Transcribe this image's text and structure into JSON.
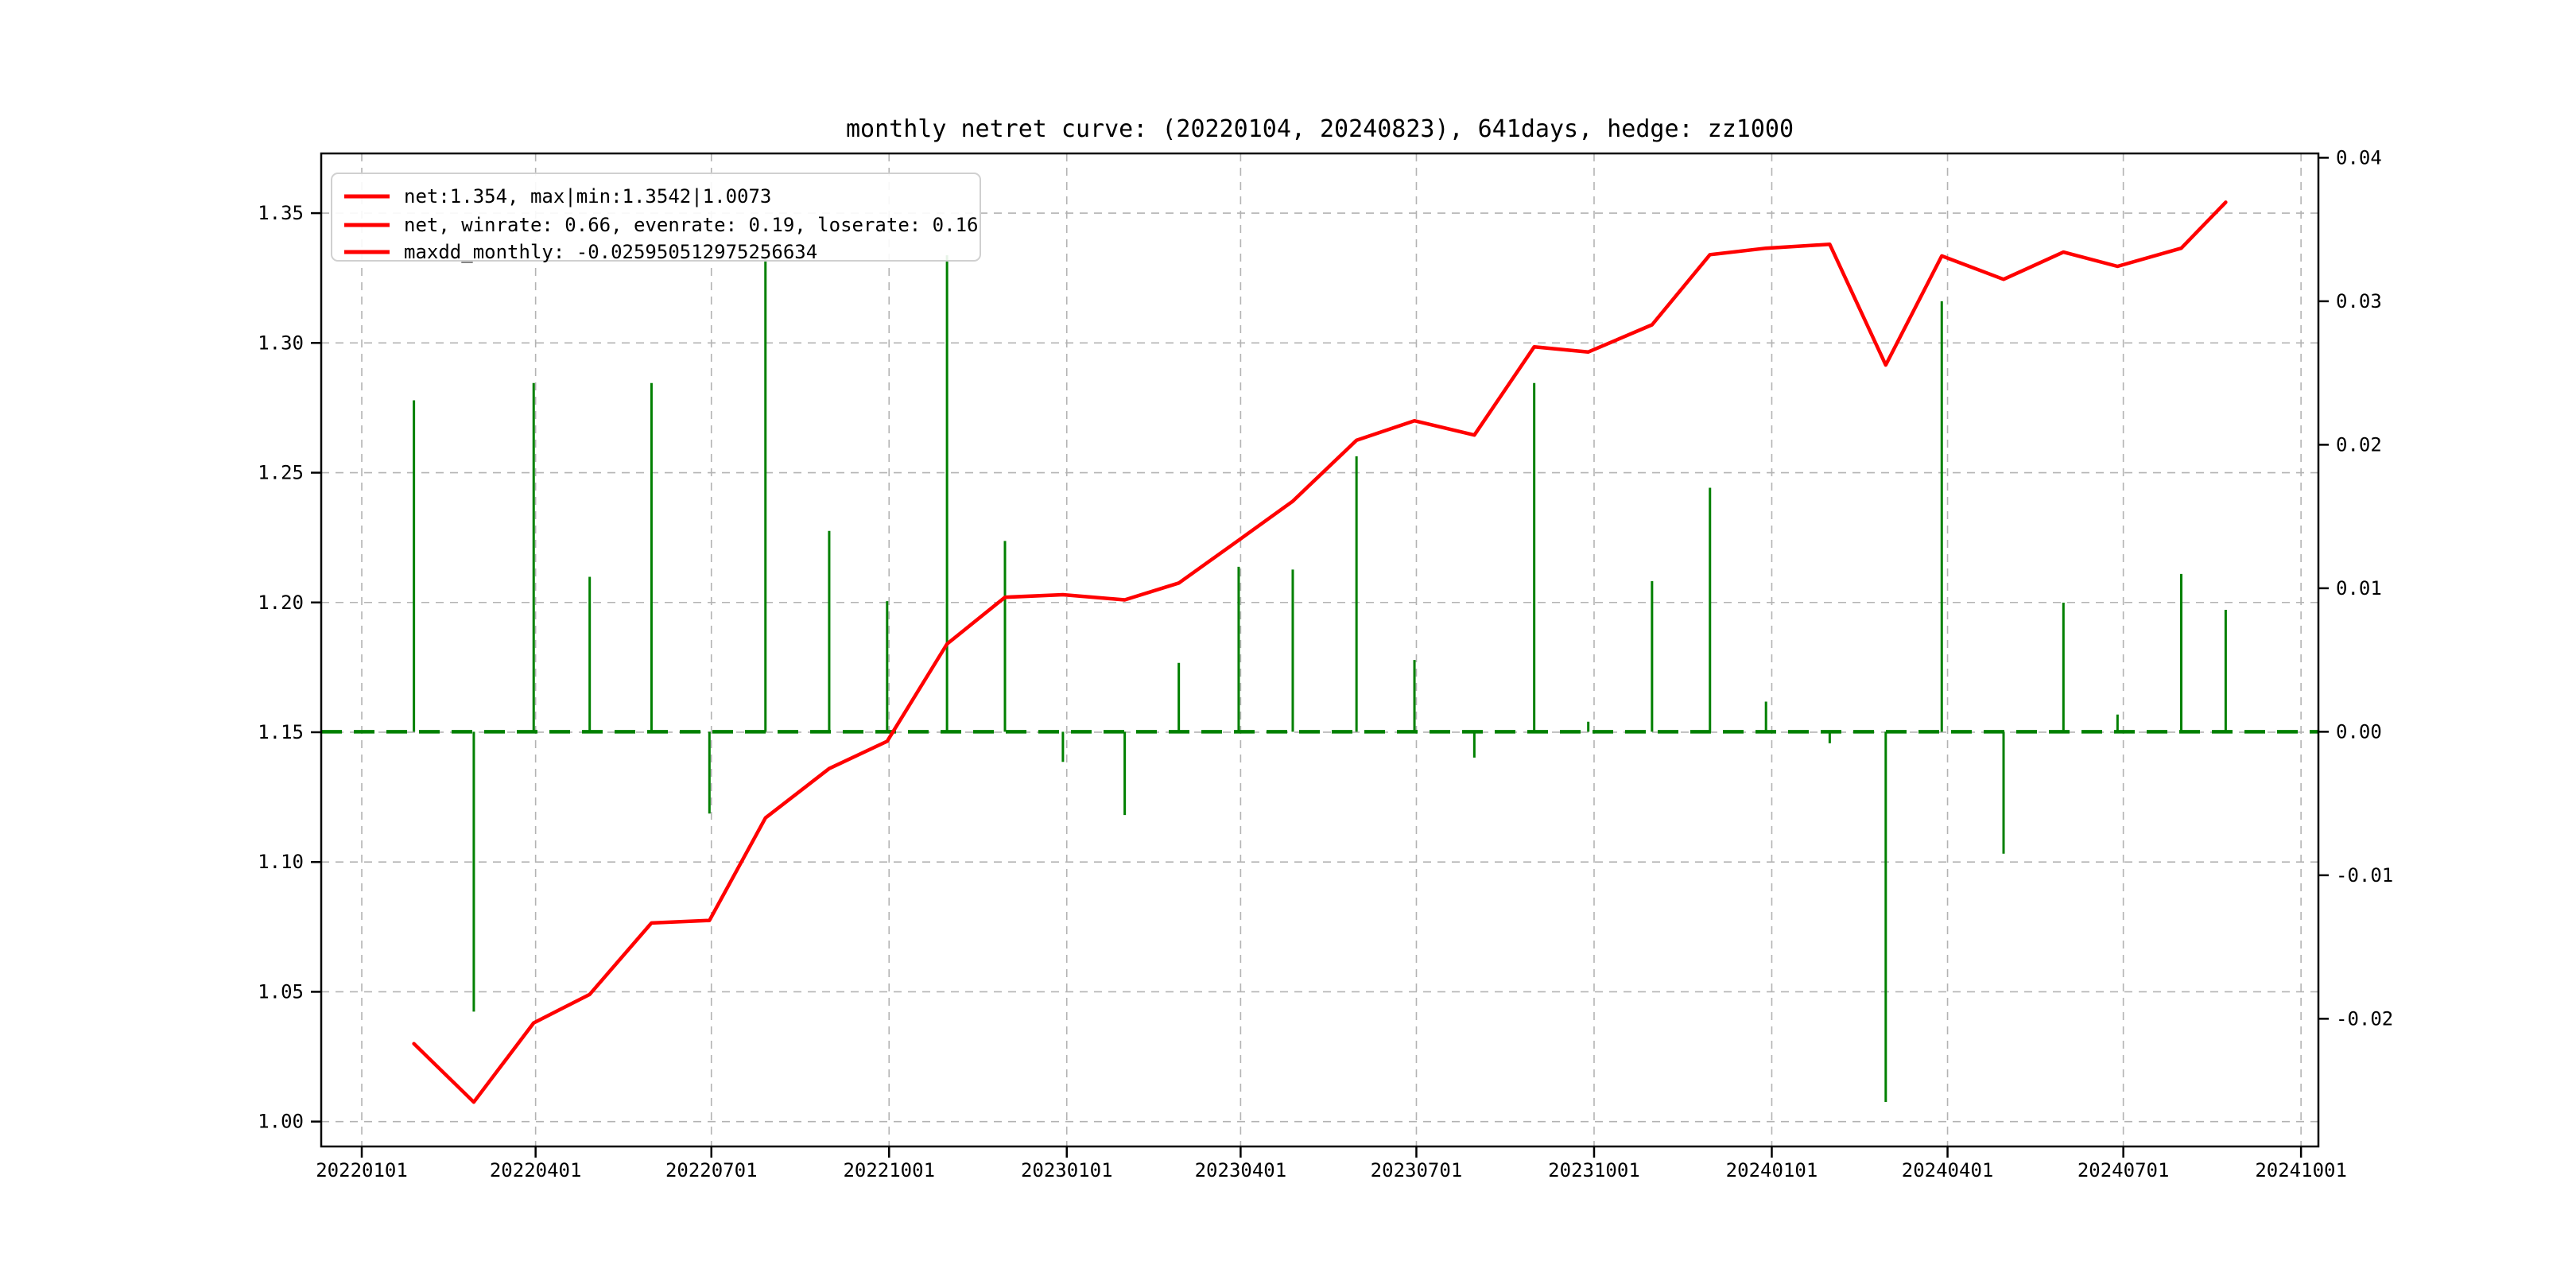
{
  "chart_data": {
    "type": "line+bar",
    "title": "monthly netret curve: (20220104, 20240823), 641days, hedge: zz1000",
    "legend": {
      "position": "upper-left",
      "entries": [
        {
          "label": "net:1.354, max|min:1.3542|1.0073",
          "color": "#ff0000"
        },
        {
          "label": "net, winrate: 0.66, evenrate: 0.19, loserate: 0.16",
          "color": "#ff0000"
        },
        {
          "label": "maxdd_monthly: -0.025950512975256634",
          "color": "#ff0000"
        }
      ]
    },
    "x_axis": {
      "min": "20211211",
      "max": "20241010",
      "tick_labels": [
        "20220101",
        "20220401",
        "20220701",
        "20221001",
        "20230101",
        "20230401",
        "20230701",
        "20231001",
        "20240101",
        "20240401",
        "20240701",
        "20241001"
      ]
    },
    "left_axis": {
      "series": "net",
      "range": [
        0.9904,
        1.373
      ],
      "tick_values": [
        1.0,
        1.05,
        1.1,
        1.15,
        1.2,
        1.25,
        1.3,
        1.35
      ],
      "tick_labels": [
        "1.00",
        "1.05",
        "1.10",
        "1.15",
        "1.20",
        "1.25",
        "1.30",
        "1.35"
      ]
    },
    "right_axis": {
      "series": "monthly_return",
      "range": [
        -0.0289,
        0.0403
      ],
      "tick_values": [
        0.04,
        0.03,
        0.02,
        0.01,
        0.0,
        -0.01,
        -0.02
      ],
      "tick_labels": [
        "0.04",
        "0.03",
        "0.02",
        "0.01",
        "0.00",
        "-0.01",
        "-0.02"
      ]
    },
    "zero_line": {
      "value": 0.0,
      "axis": "right",
      "color": "#008000",
      "style": "dashed"
    },
    "grid": {
      "show": true,
      "color": "#b3b3b3",
      "style": "dashed"
    },
    "months": [
      "202201",
      "202202",
      "202203",
      "202204",
      "202205",
      "202206",
      "202207",
      "202208",
      "202209",
      "202210",
      "202211",
      "202212",
      "202301",
      "202302",
      "202303",
      "202304",
      "202305",
      "202306",
      "202307",
      "202308",
      "202309",
      "202310",
      "202311",
      "202312",
      "202401",
      "202402",
      "202403",
      "202404",
      "202405",
      "202406",
      "202407",
      "202408"
    ],
    "point_dates": [
      "20220128",
      "20220228",
      "20220331",
      "20220429",
      "20220531",
      "20220630",
      "20220729",
      "20220831",
      "20220930",
      "20221031",
      "20221130",
      "20221230",
      "20230131",
      "20230228",
      "20230331",
      "20230428",
      "20230531",
      "20230630",
      "20230731",
      "20230831",
      "20230928",
      "20231031",
      "20231130",
      "20231229",
      "20240131",
      "20240229",
      "20240329",
      "20240430",
      "20240531",
      "20240628",
      "20240731",
      "20240823"
    ],
    "series": [
      {
        "name": "net",
        "type": "line",
        "axis": "left",
        "color": "#ff0000",
        "values": [
          1.03,
          1.0075,
          1.038,
          1.049,
          1.0765,
          1.0775,
          1.117,
          1.136,
          1.1465,
          1.184,
          1.202,
          1.203,
          1.201,
          1.2075,
          1.224,
          1.239,
          1.2625,
          1.27,
          1.2645,
          1.2985,
          1.2965,
          1.307,
          1.334,
          1.3365,
          1.338,
          1.2915,
          1.3335,
          1.3245,
          1.335,
          1.3295,
          1.3365,
          1.3542
        ]
      },
      {
        "name": "monthly_return",
        "type": "bar",
        "axis": "right",
        "color": "#008000",
        "values": [
          0.0231,
          -0.0195,
          0.0243,
          0.0108,
          0.0243,
          -0.0057,
          0.033,
          0.014,
          0.0091,
          0.0332,
          0.0133,
          -0.0021,
          -0.0058,
          0.0048,
          0.0115,
          0.0113,
          0.0192,
          0.005,
          -0.0018,
          0.0243,
          0.0007,
          0.0105,
          0.017,
          0.0021,
          -0.0008,
          -0.0258,
          0.03,
          -0.0085,
          0.009,
          0.0012,
          0.011,
          0.0085
        ]
      }
    ]
  }
}
